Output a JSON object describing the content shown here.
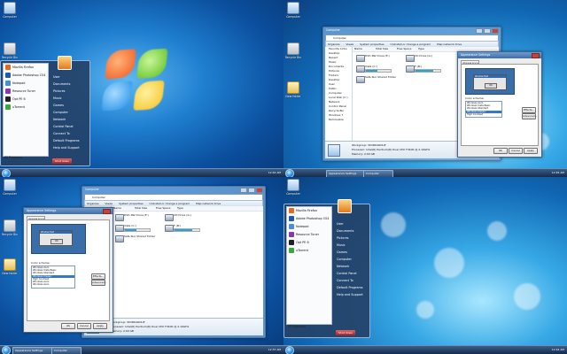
{
  "desktop": {
    "icons": {
      "computer": "Computer",
      "recycle_bin": "Recycle Bin",
      "folder": "New folder"
    }
  },
  "taskbar": {
    "clock": "12:44 AM",
    "clock_q2": "12:45 AM",
    "clock_q3": "12:37 AM",
    "clock_q4": "12:44 AM",
    "buttons": {
      "appearance": "Appearance Settings",
      "computer": "Computer"
    }
  },
  "start_menu": {
    "programs": [
      {
        "label": "Mozilla Firefox",
        "color": "#e56a1e"
      },
      {
        "label": "Adobe Photoshop CS4",
        "color": "#1e5aa8"
      },
      {
        "label": "Notepad",
        "color": "#4a8ed6"
      },
      {
        "label": "Resource Tuner",
        "color": "#8a3aa8"
      },
      {
        "label": "Opt PE 6",
        "color": "#222222"
      },
      {
        "label": "uTorrent",
        "color": "#3aa83a"
      }
    ],
    "all_programs": "All Programs",
    "links": [
      "User",
      "Documents",
      "Pictures",
      "Music",
      "Games",
      "Computer",
      "Network",
      "Control Panel",
      "Connect To",
      "Default Programs",
      "Help and Support"
    ],
    "shutdown": "Shut down"
  },
  "explorer": {
    "title": "Computer",
    "address": "Computer",
    "toolbar": [
      "Organize",
      "Views",
      "System properties",
      "Uninstall or change a program",
      "Map network drive"
    ],
    "nav": [
      "Favorite Links",
      "Desktop",
      "Recent",
      "Music",
      "Documents",
      "Pictures",
      "Folders",
      "Desktop",
      "User",
      "Public",
      "Computer",
      "Local Disk (C:)",
      "Network",
      "Control Panel",
      "Recycle Bin",
      "Windows 7",
      "Removable"
    ],
    "columns": [
      "Name",
      "Total Size",
      "Free Space",
      "Type"
    ],
    "drives": [
      {
        "label": "DVD RW Drive (E:)",
        "fill": 0
      },
      {
        "label": "CD Drive (G:)",
        "fill": 0
      },
      {
        "label": "Vista (C:)",
        "fill": 0.45
      },
      {
        "label": "F (B:)",
        "fill": 0.7
      },
      {
        "label": "Safe Run Shared Folder",
        "fill": 0
      }
    ],
    "details": {
      "workgroup": "Workgroup: WORKGROUP",
      "processor": "Processor: Intel(R) Pentium(R) Dual CPU T3400 @ 2.16GHz",
      "memory": "Memory: 2.00 GB"
    }
  },
  "appearance_dialog": {
    "title": "Appearance Settings",
    "tab": "Appearance",
    "preview_title": "Window Text",
    "preview_button": "OK",
    "color_scheme_label": "Color scheme:",
    "schemes": [
      "Windows Aero",
      "Windows Vista Basic",
      "Windows Standard",
      "Windows Classic",
      "High Contrast",
      "Windows Aero",
      "Windows Aero"
    ],
    "selected_scheme": 3,
    "effects": "Effects...",
    "advanced": "Advanced...",
    "ok": "OK",
    "cancel": "Cancel",
    "apply": "Apply"
  }
}
